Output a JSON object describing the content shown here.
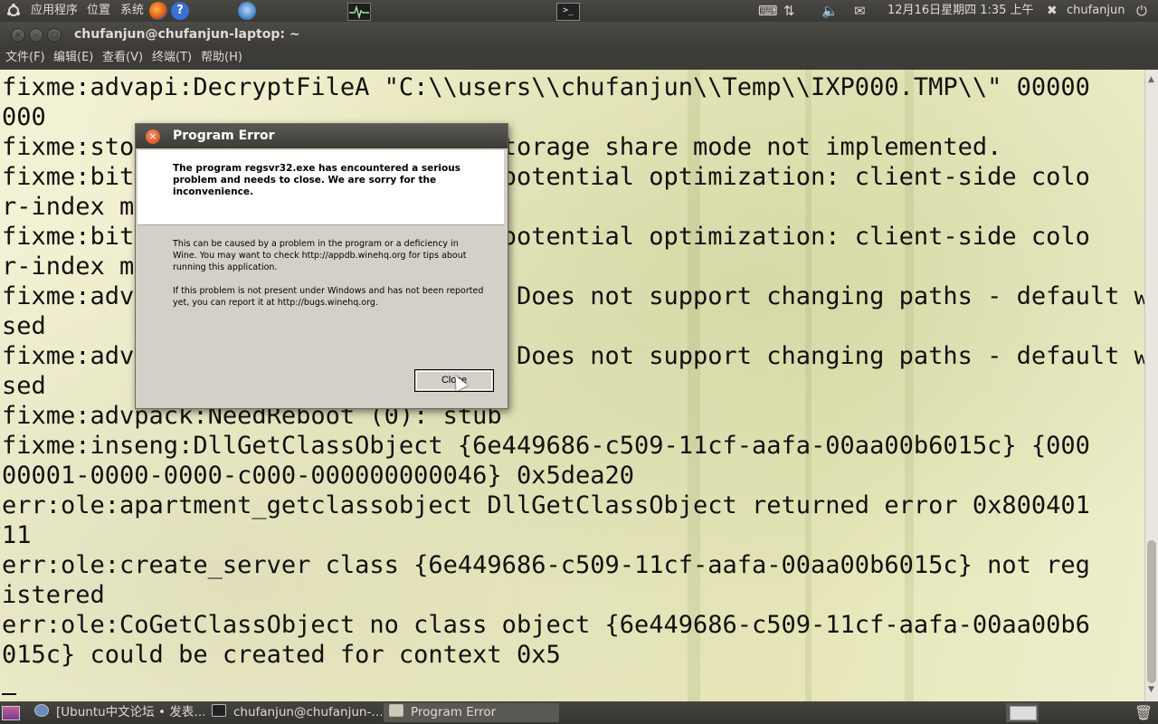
{
  "top_panel": {
    "applications": "应用程序",
    "places": "位置",
    "system": "系统",
    "datetime": "12月16日星期四  1:35 上午",
    "username": "chufanjun"
  },
  "window": {
    "title": "chufanjun@chufanjun-laptop: ~"
  },
  "menubar": [
    "文件(F)",
    "编辑(E)",
    "查看(V)",
    "终端(T)",
    "帮助(H)"
  ],
  "terminal": {
    "lines": [
      "fixme:advapi:DecryptFileA \"C:\\\\users\\\\chufanjun\\\\Temp\\\\IXP000.TMP\\\\\" 00000",
      "000",
      "fixme:storage:create_storagefile Storage share mode not implemented.",
      "fixme:bitblt:client_side_dib_copy potential optimization: client-side colo",
      "r-index mode DIB copy",
      "fixme:bitblt:client_side_dib_copy potential optimization: client-side colo",
      "r-index mode DIB copy",
      "fixme:advpack:SetPerUserSecValuesW Does not support changing paths - default will be u",
      "sed",
      "fixme:advpack:SetPerUserSecValuesW Does not support changing paths - default will be u",
      "sed",
      "fixme:advpack:NeedReboot (0): stub",
      "fixme:inseng:DllGetClassObject {6e449686-c509-11cf-aafa-00aa00b6015c} {000",
      "00001-0000-0000-c000-000000000046} 0x5dea20",
      "err:ole:apartment_getclassobject DllGetClassObject returned error 0x800401",
      "11",
      "err:ole:create_server class {6e449686-c509-11cf-aafa-00aa00b6015c} not reg",
      "istered",
      "err:ole:CoGetClassObject no class object {6e449686-c509-11cf-aafa-00aa00b6",
      "015c} could be created for context 0x5"
    ]
  },
  "dialog": {
    "title": "Program Error",
    "header": "The program regsvr32.exe has encountered a serious problem and needs to close. We are sorry for the inconvenience.",
    "body_1": "This can be caused by a problem in the program or a deficiency in Wine. You may want to check http://appdb.winehq.org for tips about running this application.",
    "body_2": "If this problem is not present under Windows and has not been reported yet, you can report it at http://bugs.winehq.org.",
    "close_label": "Close"
  },
  "taskbar": [
    {
      "label": "[Ubuntu中文论坛 • 发表…",
      "active": false
    },
    {
      "label": "chufanjun@chufanjun-…",
      "active": false
    },
    {
      "label": "Program Error",
      "active": true
    }
  ]
}
